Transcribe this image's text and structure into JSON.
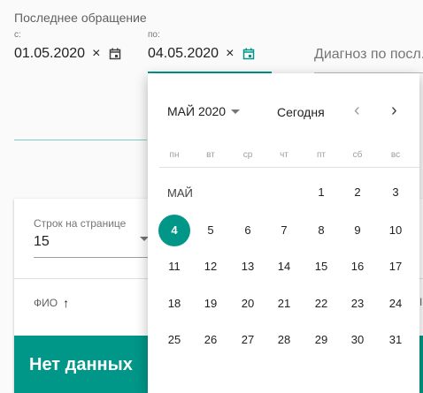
{
  "filter": {
    "title": "Последнее обращение",
    "from_label": "с:",
    "to_label": "по:",
    "from_value": "01.05.2020",
    "to_value": "04.05.2020",
    "clear_symbol": "×",
    "diagnosis_label": "Диагноз по посл."
  },
  "table": {
    "rows_per_page_label": "Строк на странице",
    "rows_per_page_value": "15",
    "sort_column": "ФИО",
    "sort_arrow": "↑",
    "no_data": "Нет данных",
    "edge_mark": "I"
  },
  "datepicker": {
    "month_year": "МАЙ 2020",
    "today_label": "Сегодня",
    "prev": "‹",
    "next": "›",
    "weekdays": [
      "пн",
      "вт",
      "ср",
      "чт",
      "пт",
      "сб",
      "вс"
    ],
    "month_abbr": "МАЙ",
    "selected_day": 4,
    "days": [
      "1",
      "2",
      "3",
      "4",
      "5",
      "6",
      "7",
      "8",
      "9",
      "10",
      "11",
      "12",
      "13",
      "14",
      "15",
      "16",
      "17",
      "18",
      "19",
      "20",
      "21",
      "22",
      "23",
      "24",
      "25",
      "26",
      "27",
      "28",
      "29",
      "30",
      "31"
    ]
  },
  "colors": {
    "accent": "#009688"
  }
}
